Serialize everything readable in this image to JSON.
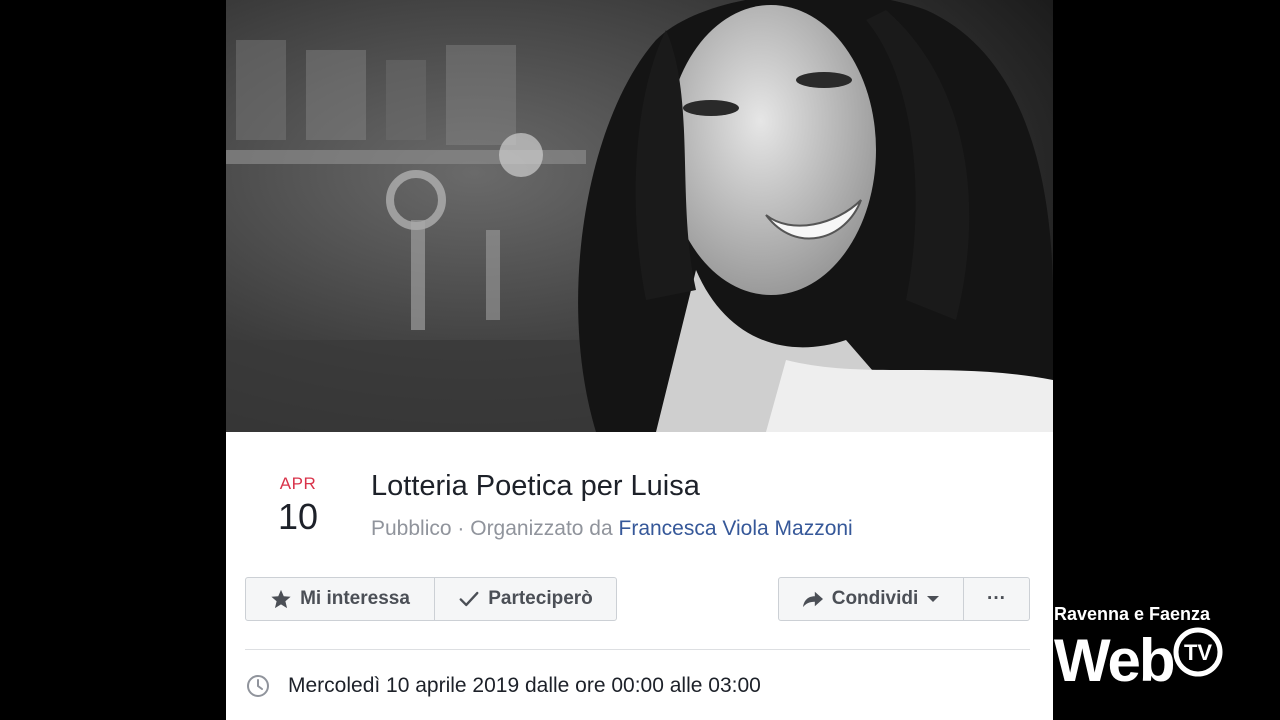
{
  "event": {
    "month": "APR",
    "day": "10",
    "title": "Lotteria Poetica per Luisa",
    "visibility": "Pubblico",
    "separator": " · ",
    "organized_by_label": "Organizzato da ",
    "organizer": "Francesca Viola Mazzoni",
    "datetime": "Mercoledì 10 aprile 2019 dalle ore 00:00 alle 03:00"
  },
  "actions": {
    "interested_label": "Mi interessa",
    "going_label": "Parteciperò",
    "share_label": "Condividi",
    "more_label": "···"
  },
  "icons": {
    "interested": "star-icon",
    "going": "check-icon",
    "share": "share-arrow-icon",
    "share_dropdown": "caret-down-icon",
    "time": "clock-icon"
  },
  "watermark": {
    "line1": "Ravenna e Faenza",
    "brand": "Web",
    "badge": "TV"
  },
  "colors": {
    "month_red": "#d9334a",
    "link_blue": "#365899",
    "button_bg": "#f5f6f7",
    "button_text": "#4b4f56"
  }
}
